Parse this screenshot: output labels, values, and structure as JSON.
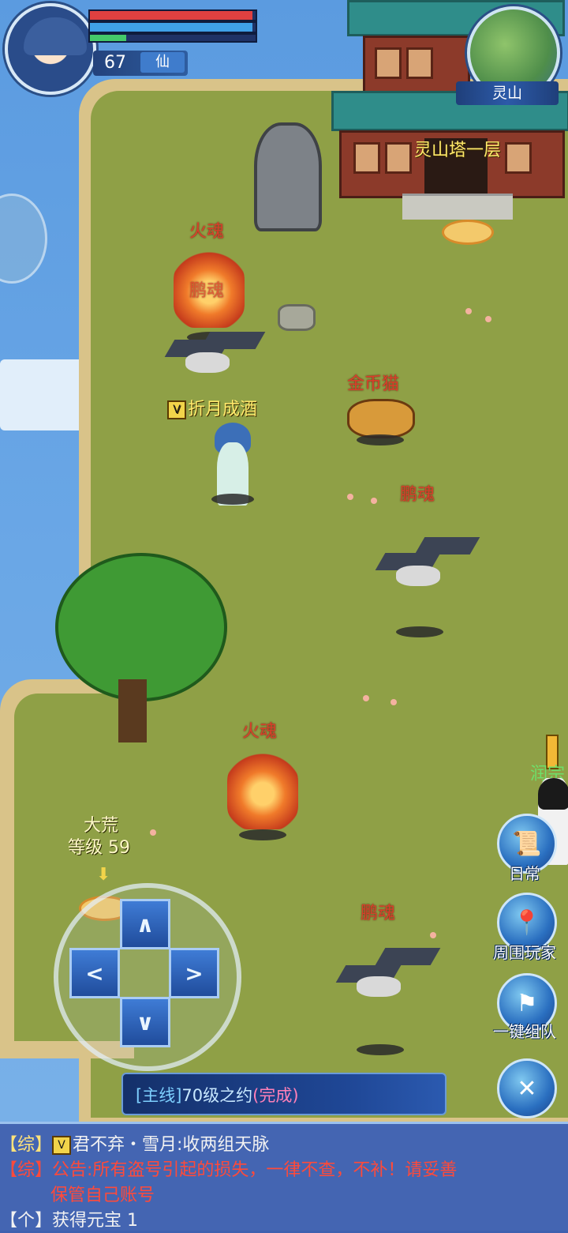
{
  "hud": {
    "level": "67",
    "realm": "仙",
    "hp_fraction": 0.98,
    "mp_fraction": 0.98,
    "xp_fraction": 0.22
  },
  "minimap": {
    "location": "灵山"
  },
  "map_labels": {
    "tower": "灵山塔一层",
    "fire_soul_top": "火魂",
    "peng_soul_top": "鹏魂",
    "player_name": "折月成酒",
    "gold_cat": "金币猫",
    "peng_soul_mid": "鹏魂",
    "fire_soul_bottom": "火魂",
    "dahuang_title": "大荒",
    "dahuang_level_label": "等级",
    "dahuang_level": "59",
    "peng_soul_bottom": "鹏魂",
    "npc_right": "润宗"
  },
  "actions": {
    "daily": "日常",
    "nearby_players": "周围玩家",
    "one_click_team": "一键组队"
  },
  "dpad": {
    "up": "∧",
    "left": "<",
    "right": ">",
    "down": "∨"
  },
  "quest": {
    "tag": "[主线]",
    "title": "70级之约",
    "status": "(完成)"
  },
  "chat": {
    "line1_channel": "【综】",
    "line1_text": "君不弃・雪月:收两组天脉",
    "line2_channel": "【综】",
    "line2_text": "公告:所有盗号引起的损失，一律不查，不补！请妥善",
    "line3_text": "保管自己账号",
    "line4_channel": "【个】",
    "line4_text": "获得元宝  1"
  },
  "colors": {
    "accent": "#2a6fc0",
    "enemy_name": "#d8402a",
    "player_name": "#ffe96b",
    "quest_status": "#ff80b8"
  }
}
